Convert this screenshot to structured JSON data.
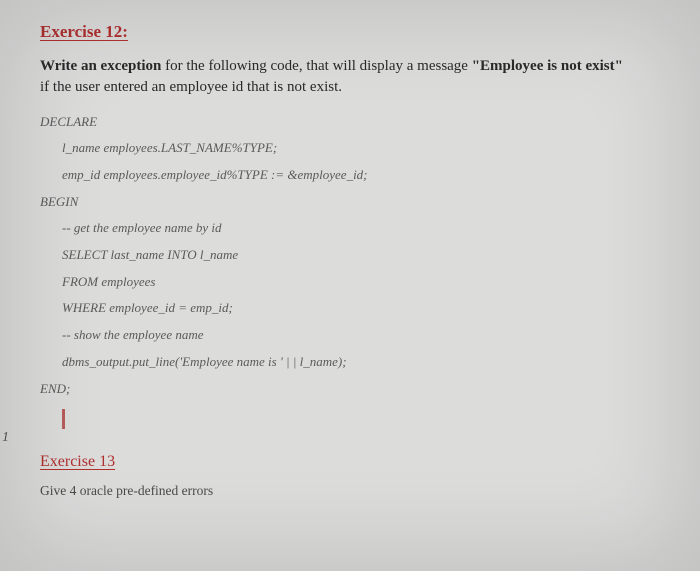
{
  "ex12": {
    "title": "Exercise 12:",
    "prompt_pre": "Write an exception",
    "prompt_mid": " for the following code, that will display a message ",
    "prompt_msg": "\"Employee is not exist\"",
    "prompt_post": "if the user entered an employee id that is not exist.",
    "code": {
      "declare": "DECLARE",
      "l1": "l_name employees.LAST_NAME%TYPE;",
      "l2": "emp_id employees.employee_id%TYPE := &employee_id;",
      "begin": "BEGIN",
      "c1": "-- get the employee name by id",
      "c2": "SELECT last_name INTO l_name",
      "c3": "FROM employees",
      "c4": "WHERE employee_id = emp_id;",
      "c5": "-- show the employee name",
      "c6": "dbms_output.put_line('Employee name is ' | | l_name);",
      "end": "END;"
    }
  },
  "ex13": {
    "title": "Exercise 13",
    "prompt": "Give 4 oracle pre-defined errors"
  },
  "margin_tag": "1"
}
